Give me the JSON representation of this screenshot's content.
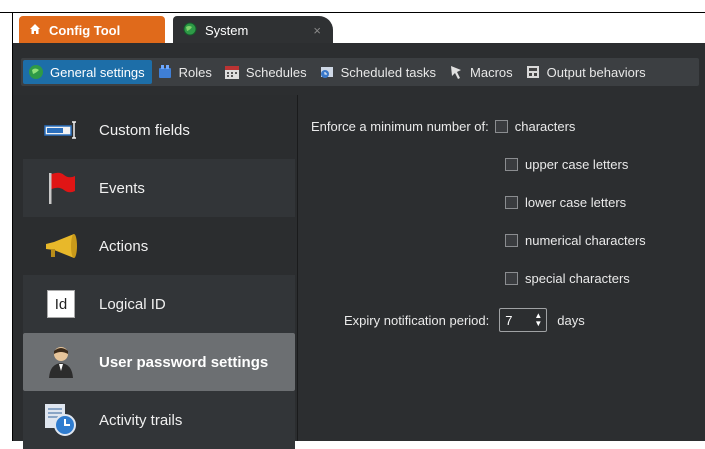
{
  "tabs": [
    {
      "label": "Config Tool",
      "icon": "home-icon"
    },
    {
      "label": "System",
      "icon": "globe-icon",
      "close": "×"
    }
  ],
  "toolbar": {
    "items": [
      {
        "label": "General settings",
        "icon": "globe-icon",
        "active": true
      },
      {
        "label": "Roles",
        "icon": "roles-icon"
      },
      {
        "label": "Schedules",
        "icon": "calendar-icon"
      },
      {
        "label": "Scheduled tasks",
        "icon": "scheduled-task-icon"
      },
      {
        "label": "Macros",
        "icon": "macro-icon"
      },
      {
        "label": "Output behaviors",
        "icon": "output-behavior-icon"
      }
    ]
  },
  "sidebar": {
    "items": [
      {
        "label": "Custom fields",
        "icon": "custom-fields-icon"
      },
      {
        "label": "Events",
        "icon": "flag-icon"
      },
      {
        "label": "Actions",
        "icon": "megaphone-icon"
      },
      {
        "label": "Logical ID",
        "icon": "id-icon",
        "icon_text": "Id"
      },
      {
        "label": "User password settings",
        "icon": "user-icon",
        "selected": true
      },
      {
        "label": "Activity trails",
        "icon": "activity-trails-icon"
      }
    ]
  },
  "password": {
    "enforce_label": "Enforce a minimum number of:",
    "options": [
      {
        "label": "characters",
        "checked": false
      },
      {
        "label": "upper case letters",
        "checked": false
      },
      {
        "label": "lower case letters",
        "checked": false
      },
      {
        "label": "numerical characters",
        "checked": false
      },
      {
        "label": "special characters",
        "checked": false
      }
    ],
    "expiry_label": "Expiry notification period:",
    "expiry_value": "7",
    "expiry_unit": "days"
  },
  "colors": {
    "accent_orange": "#e06a1b",
    "selected_blue": "#1d6ea8",
    "panel_dark": "#2c2e30"
  }
}
